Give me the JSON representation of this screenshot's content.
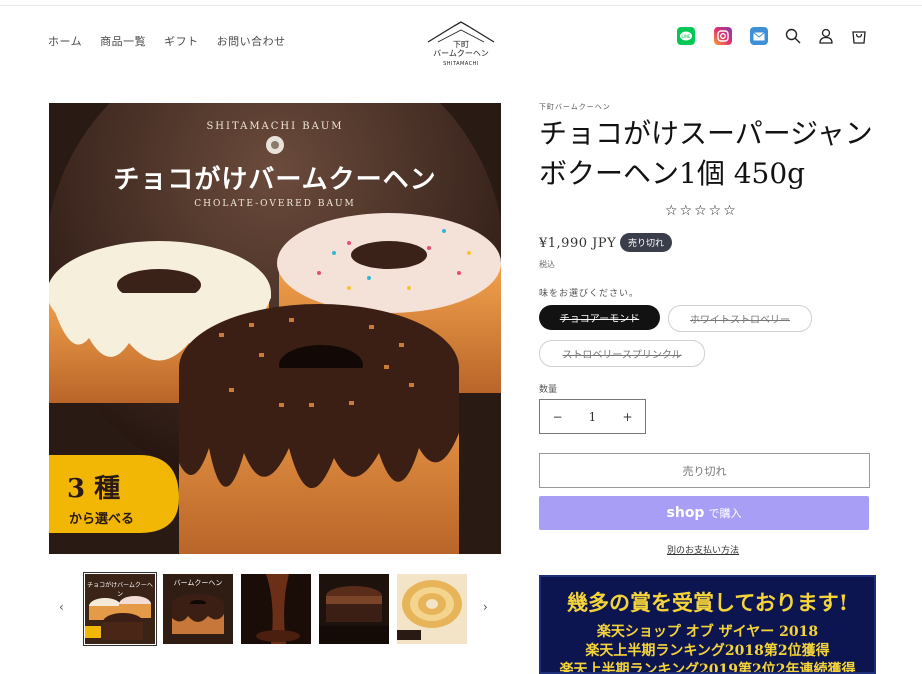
{
  "header": {
    "nav": [
      "ホーム",
      "商品一覧",
      "ギフト",
      "お問い合わせ"
    ],
    "logo": {
      "name": "下町\nバームクーヘン",
      "sub": "SHITAMACHI"
    }
  },
  "gallery": {
    "hero": {
      "brand_en": "SHITAMACHI BAUM",
      "headline": "チョコがけバームクーヘン",
      "subline": "CHOLATE-OVERED BAUM",
      "badge_big": "3 種",
      "badge_small": "から選べる"
    },
    "thumbs": [
      {
        "label": "チョコがけバームクーヘン"
      },
      {
        "label": "バームクーヘン"
      },
      {
        "label": ""
      },
      {
        "label": ""
      },
      {
        "label": ""
      }
    ],
    "prev": "‹",
    "next": "›"
  },
  "product": {
    "brand": "下町バームクーヘン",
    "title": "チョコがけスーパージャンボクーヘン1個 450g",
    "stars": "☆☆☆☆☆",
    "price": "¥1,990 JPY",
    "sold_badge": "売り切れ",
    "tax": "税込",
    "variant_label": "味をお選びください。",
    "variants": [
      "チョコアーモンド",
      "ホワイトストロベリー",
      "ストロベリースプリンクル"
    ],
    "qty_label": "数量",
    "qty_minus": "−",
    "qty_value": "1",
    "qty_plus": "+",
    "soldout_button": "売り切れ",
    "shop_brand": "shop",
    "shop_label": "で購入",
    "more_pay": "別のお支払い方法"
  },
  "banner": {
    "line1": "幾多の賞を受賞しております!",
    "line2": "楽天ショップ オブ ザイヤー 2018",
    "line3": "楽天上半期ランキング2018第2位獲得",
    "line4": "楽天上半期ランキング2019第2位2年連続獲得"
  },
  "colors": {
    "accent": "#a99ef6",
    "badge": "#3a3d4a",
    "banner_bg": "#0c1550",
    "banner_text": "#f5d43a"
  }
}
